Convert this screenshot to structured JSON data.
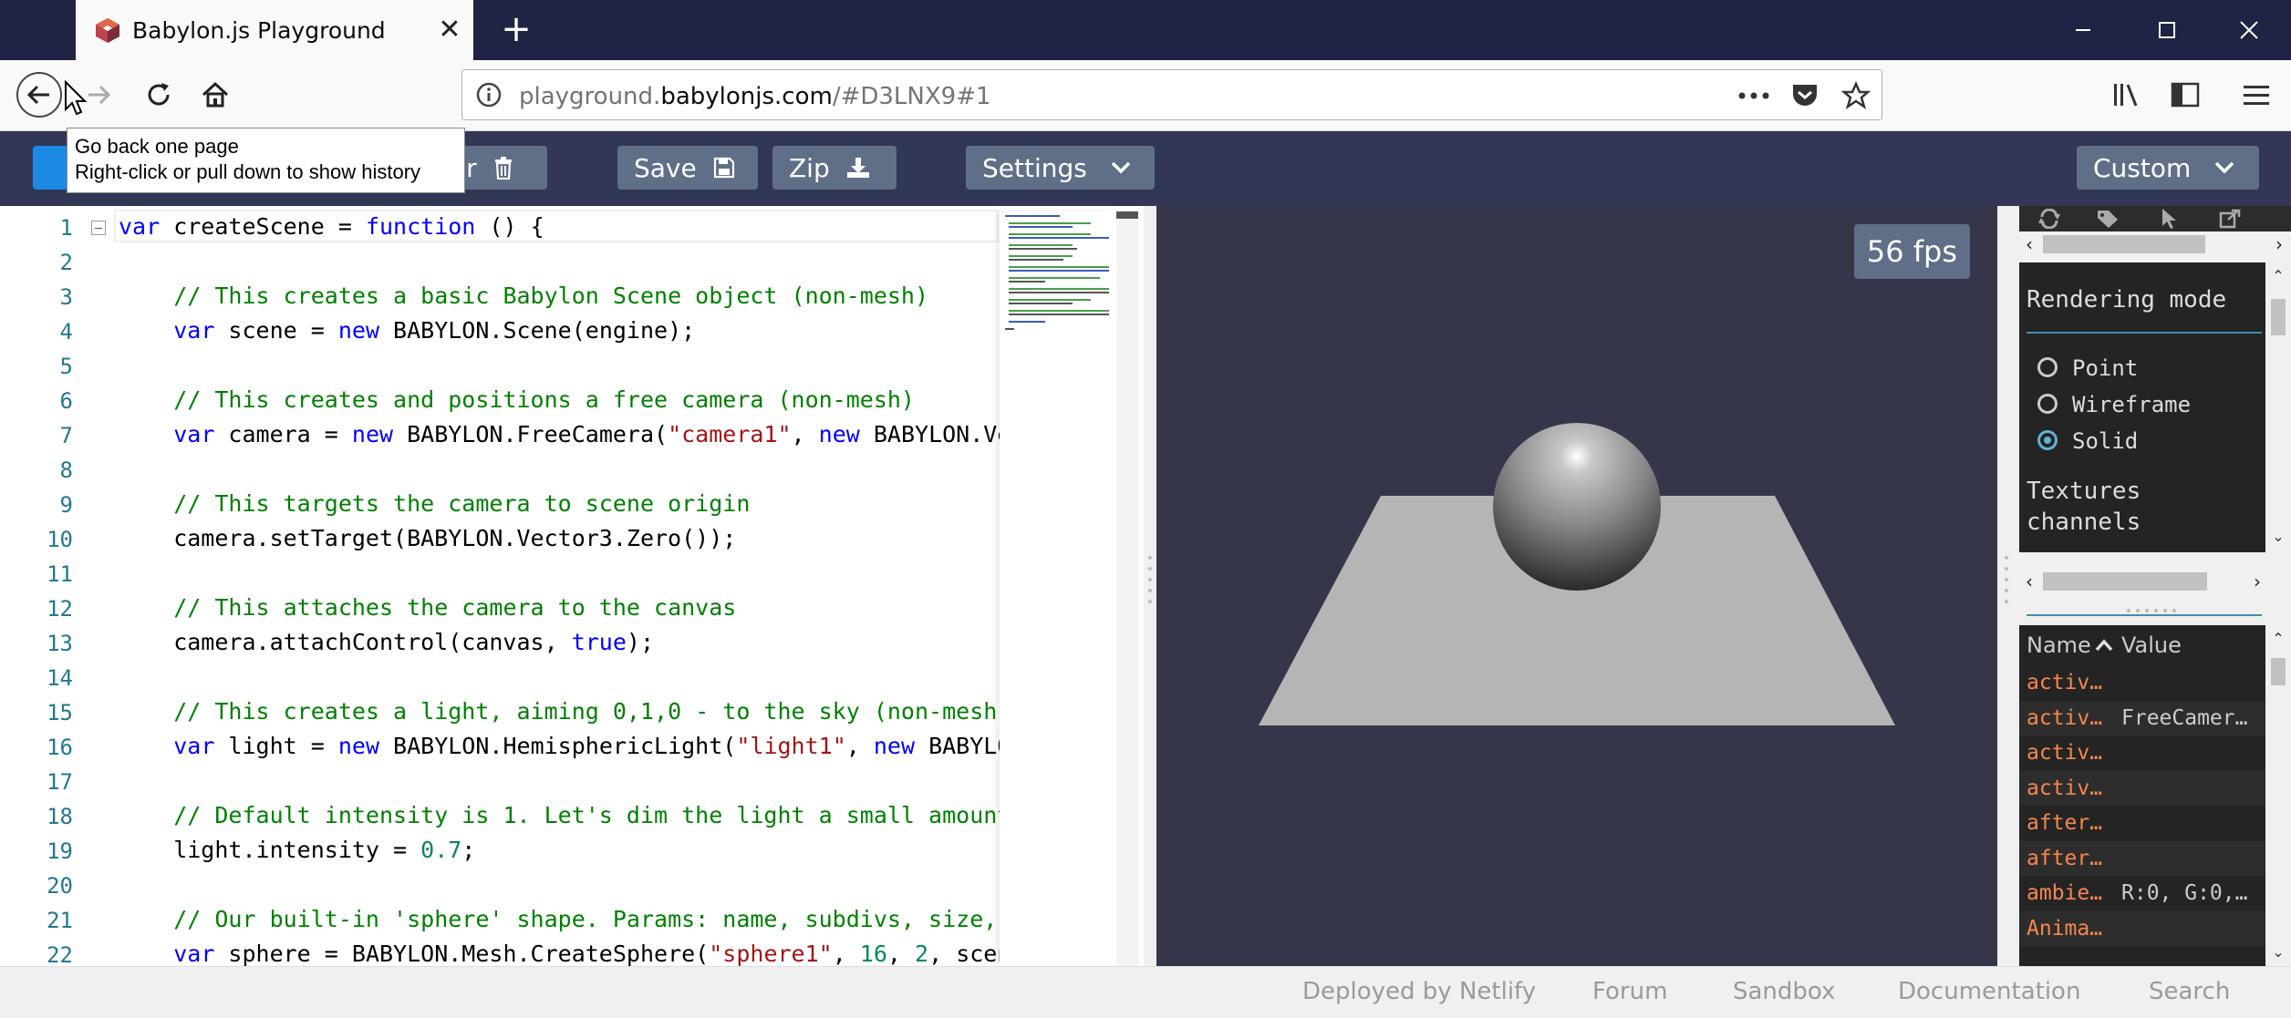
{
  "browser": {
    "tab_title": "Babylon.js Playground",
    "url_domain_prefix": "playground.",
    "url_domain": "babylonjs.com",
    "url_path": "/#D3LNX9#1",
    "tooltip_line1": "Go back one page",
    "tooltip_line2": "Right-click or pull down to show history"
  },
  "toolbar": {
    "clear_fragment": "ar",
    "save_label": "Save",
    "zip_label": "Zip",
    "settings_label": "Settings",
    "custom_label": "Custom"
  },
  "editor": {
    "line_numbers": [
      "1",
      "2",
      "3",
      "4",
      "5",
      "6",
      "7",
      "8",
      "9",
      "10",
      "11",
      "12",
      "13",
      "14",
      "15",
      "16",
      "17",
      "18",
      "19",
      "20",
      "21",
      "22"
    ]
  },
  "canvas": {
    "fps": "56 fps"
  },
  "inspector": {
    "rendering_mode_title": "Rendering mode",
    "modes": [
      "Point",
      "Wireframe",
      "Solid"
    ],
    "selected_mode": "Solid",
    "textures_title_1": "Textures",
    "textures_title_2": "channels",
    "col_name": "Name",
    "col_value": "Value",
    "rows": [
      {
        "name": "activ…",
        "value": ""
      },
      {
        "name": "activ…",
        "value": "FreeCamer…"
      },
      {
        "name": "activ…",
        "value": ""
      },
      {
        "name": "activ…",
        "value": ""
      },
      {
        "name": "after…",
        "value": ""
      },
      {
        "name": "after…",
        "value": ""
      },
      {
        "name": "ambie…",
        "value": "R:0, G:0,…"
      },
      {
        "name": "Anima…",
        "value": ""
      }
    ]
  },
  "footer": {
    "links": [
      "Deployed by Netlify",
      "Forum",
      "Sandbox",
      "Documentation",
      "Search"
    ]
  },
  "colors": {
    "tabbar": "#1f2444",
    "pg_bar": "#323755",
    "button": "#5f6f88",
    "canvas_bg": "#36364a",
    "run_button": "#1e88e5"
  }
}
